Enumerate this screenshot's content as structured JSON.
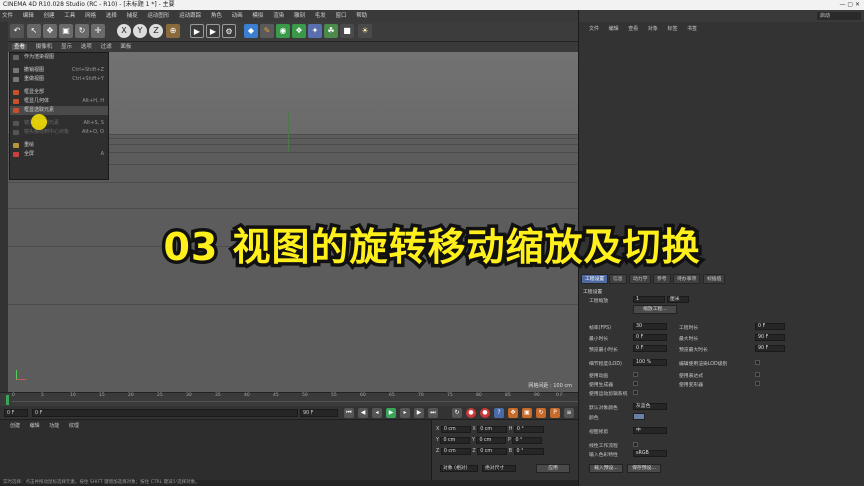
{
  "title_bar": {
    "text": "CINEMA 4D R10.028 Studio (RC - R10) - [未标题 1 *] - 主要",
    "controls": "— ▢ ✕"
  },
  "menubar": [
    "文件",
    "编辑",
    "创建",
    "工具",
    "网格",
    "选择",
    "捕捉",
    "运动图形",
    "运动跟踪",
    "角色",
    "动画",
    "模拟",
    "渲染",
    "雕刻",
    "毛发",
    "窗口",
    "帮助"
  ],
  "viewport": {
    "menu": [
      "查看",
      "摄像机",
      "显示",
      "选项",
      "过滤",
      "面板"
    ],
    "scale_text": "网格间距 : 100 cm"
  },
  "view_menu": {
    "items": [
      {
        "label": "作为渲染视图",
        "shortcut": "",
        "icon_color": "#666666",
        "disabled": false
      },
      {
        "label": "撤销视图",
        "shortcut": "Ctrl+Shift+Z",
        "icon_color": "#777777",
        "disabled": false
      },
      {
        "label": "重做视图",
        "shortcut": "Ctrl+Shift+Y",
        "icon_color": "#777777",
        "disabled": false
      },
      {
        "label": "框显全部",
        "shortcut": "",
        "icon_color": "#c8502a",
        "disabled": false
      },
      {
        "label": "框显几何体",
        "shortcut": "Alt+H, H",
        "icon_color": "#c8502a",
        "disabled": false
      },
      {
        "label": "框显选取元素",
        "shortcut": "",
        "icon_color": "#c8502a",
        "disabled": false
      },
      {
        "label": "镜头移动到元素",
        "shortcut": "Alt+S, S",
        "icon_color": "#555555",
        "disabled": true
      },
      {
        "label": "镜头移动到中心对象",
        "shortcut": "Alt+O, O",
        "icon_color": "#555555",
        "disabled": true
      },
      {
        "label": "重绘",
        "shortcut": "",
        "icon_color": "#b8953a",
        "disabled": false
      },
      {
        "label": "全屏",
        "shortcut": "A",
        "icon_color": "#c84040",
        "disabled": false
      }
    ]
  },
  "right_panel": {
    "menu": [
      "文件",
      "编辑",
      "查看",
      "对象",
      "标签",
      "书签"
    ],
    "layout_label": "启动"
  },
  "overlay_title": "03 视图的旋转移动缩放及切换",
  "attributes": {
    "tabs": [
      "工程设置",
      "信息",
      "动力学",
      "参考",
      "待办事项",
      "帧插值"
    ],
    "section": "工程设置",
    "fields": [
      {
        "label": "工程缩放",
        "value": "1"
      },
      {
        "label": "",
        "value": "缩放工程..."
      },
      {
        "label": "帧率(FPS)",
        "value": "30"
      },
      {
        "label": "工程时长",
        "value": "0 F"
      },
      {
        "label": "最小时长",
        "value": "0 F"
      },
      {
        "label": "最大时长",
        "value": "90 F"
      },
      {
        "label": "预览最小时长",
        "value": "0 F"
      },
      {
        "label": "预览最大时长",
        "value": "90 F"
      },
      {
        "label": "细节程度(LOD)",
        "value": "100 %"
      },
      {
        "label": "编辑使用渲染LOD级别",
        "value": ""
      },
      {
        "label": "使用动画",
        "value": "✓"
      },
      {
        "label": "使用表达式",
        "value": "✓"
      },
      {
        "label": "使用生成器",
        "value": "✓"
      },
      {
        "label": "使用变形器",
        "value": "✓"
      },
      {
        "label": "使用运动剪辑系统",
        "value": "✓"
      },
      {
        "label": "默认对象颜色",
        "value": "灰蓝色"
      },
      {
        "label": "颜色",
        "value": ""
      },
      {
        "label": "视图修剪",
        "value": "中"
      },
      {
        "label": "线性工作流程",
        "value": "✓"
      },
      {
        "label": "输入色彩特性",
        "value": "sRGB"
      }
    ],
    "units_label": "厘米",
    "buttons": [
      "载入预设...",
      "保存预设..."
    ]
  },
  "timeline": {
    "ticks": [
      "0",
      "5",
      "10",
      "15",
      "20",
      "25",
      "30",
      "35",
      "40",
      "45",
      "50",
      "55",
      "60",
      "65",
      "70",
      "75",
      "80",
      "85",
      "90"
    ],
    "end_frame": "0 F"
  },
  "playbar": {
    "start": "0 F",
    "current": "0 F",
    "end": "90 F",
    "end2": "90 F"
  },
  "material": {
    "menu": [
      "创建",
      "编辑",
      "功能",
      "纹理"
    ]
  },
  "coordinates": {
    "rows": [
      {
        "axis": "X",
        "pos": "0 cm",
        "size_axis": "X",
        "size": "0 cm",
        "rot_axis": "H",
        "rot": "0 °"
      },
      {
        "axis": "Y",
        "pos": "0 cm",
        "size_axis": "Y",
        "size": "0 cm",
        "rot_axis": "P",
        "rot": "0 °"
      },
      {
        "axis": "Z",
        "pos": "0 cm",
        "size_axis": "Z",
        "size": "0 cm",
        "rot_axis": "B",
        "rot": "0 °"
      }
    ],
    "mode": "对象 (相对)",
    "size_mode": "绝对尺寸",
    "apply": "应用"
  },
  "status": "实时选择：点击并拖动鼠标选择元素。按住 SHIFT 键增加选择对象；按住 CTRL 键减少选择对象。",
  "colors": {
    "accent": "#4f6aa3",
    "title_yellow": "#ffef1a",
    "viewport": "#6e6e6e"
  }
}
